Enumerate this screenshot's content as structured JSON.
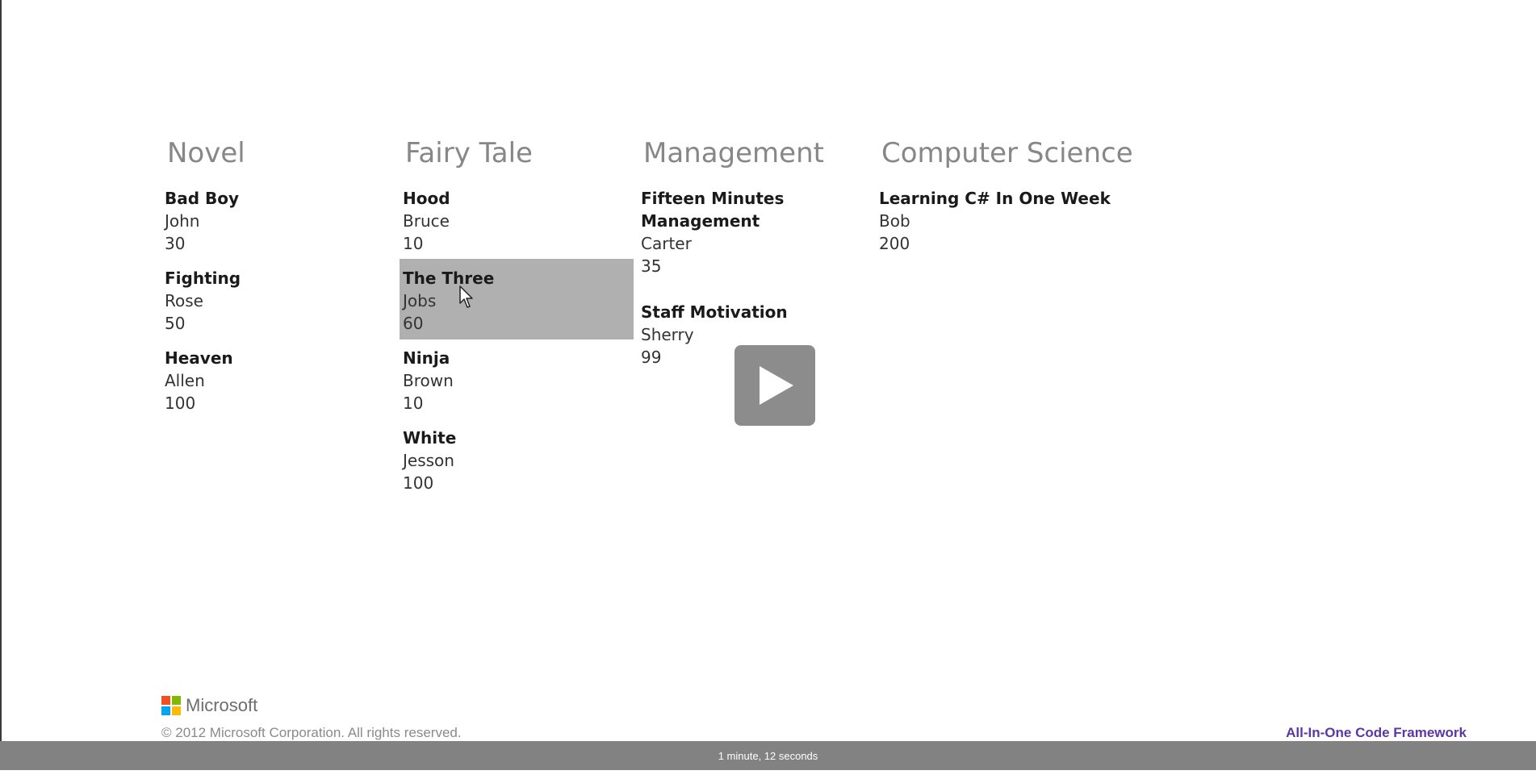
{
  "groups": [
    {
      "title": "Novel",
      "items": [
        {
          "title": "Bad Boy",
          "author": "John",
          "price": "30"
        },
        {
          "title": "Fighting",
          "author": "Rose",
          "price": "50"
        },
        {
          "title": "Heaven",
          "author": "Allen",
          "price": "100"
        }
      ]
    },
    {
      "title": "Fairy Tale",
      "items": [
        {
          "title": "Hood",
          "author": "Bruce",
          "price": "10"
        },
        {
          "title": "The Three",
          "author": "Jobs",
          "price": "60",
          "selected": true
        },
        {
          "title": "Ninja",
          "author": "Brown",
          "price": "10"
        },
        {
          "title": "White",
          "author": "Jesson",
          "price": "100"
        }
      ]
    },
    {
      "title": "Management",
      "items": [
        {
          "title_line1": "Fifteen Minutes",
          "title_line2": "Management",
          "author": "Carter",
          "price": "35"
        },
        {
          "title": "Staff Motivation",
          "author": "Sherry",
          "price": "99"
        }
      ]
    },
    {
      "title": "Computer Science",
      "items": [
        {
          "title": "Learning C# In One Week",
          "author": "Bob",
          "price": "200"
        }
      ]
    }
  ],
  "footer": {
    "brand": "Microsoft",
    "copyright": "© 2012 Microsoft Corporation. All rights reserved.",
    "link": "All-In-One Code Framework"
  },
  "player": {
    "duration": "1 minute, 12 seconds",
    "play_icon": "play-icon"
  },
  "colors": {
    "selected_bg": "#b0b0b0",
    "group_title": "#878787",
    "link": "#5b36a6",
    "status_bar": "#828282",
    "ms_red": "#f25022",
    "ms_green": "#7fba00",
    "ms_blue": "#00a4ef",
    "ms_yellow": "#ffb900"
  }
}
